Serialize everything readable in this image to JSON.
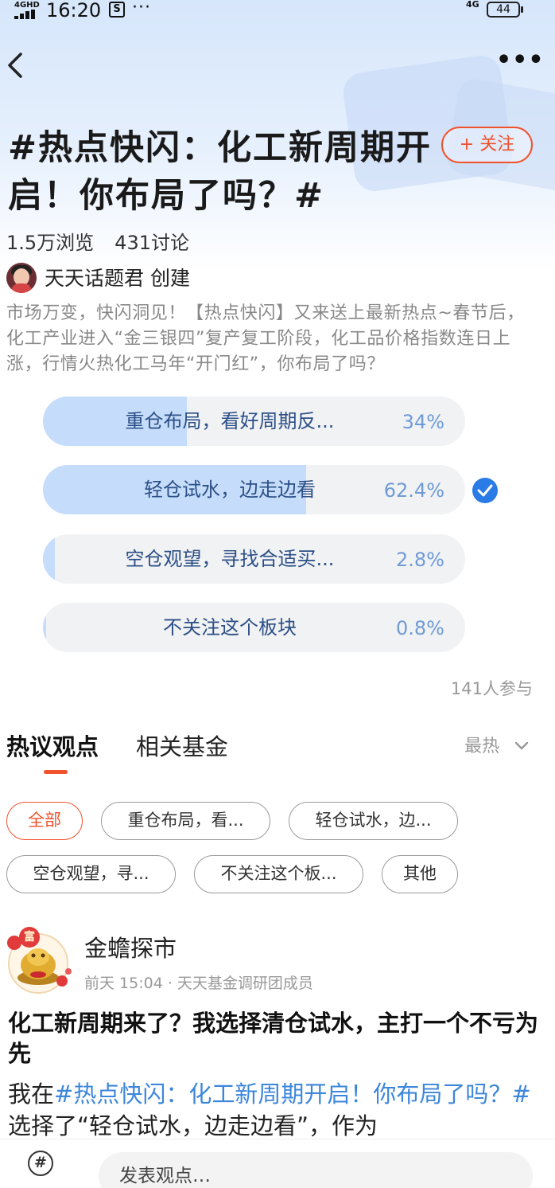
{
  "status_bar": {
    "network_left": "4GHD",
    "time": "16:20",
    "dots": "···",
    "network_right": "4G",
    "battery": "44"
  },
  "header": {
    "more_label": "•••",
    "follow_label": "+ 关注"
  },
  "topic": {
    "title": "#热点快闪：化工新周期开启！你布局了吗？#",
    "views": "1.5万浏览",
    "discussions": "431讨论",
    "creator": "天天话题君 创建",
    "description": "市场万变，快闪洞见！【热点快闪】又来送上最新热点~春节后，化工产业进入“金三银四”复产复工阶段，化工品价格指数连日上涨，行情火热化工马年“开门红”，你布局了吗？"
  },
  "poll": {
    "options": [
      {
        "label": "重仓布局，看好周期反...",
        "percent": "34%",
        "value": 0.34,
        "selected": false
      },
      {
        "label": "轻仓试水，边走边看",
        "percent": "62.4%",
        "value": 0.624,
        "selected": true
      },
      {
        "label": "空仓观望，寻找合适买...",
        "percent": "2.8%",
        "value": 0.028,
        "selected": false
      },
      {
        "label": "不关注这个板块",
        "percent": "0.8%",
        "value": 0.008,
        "selected": false
      }
    ],
    "participants": "141人参与"
  },
  "tabs": {
    "hot": "热议观点",
    "funds": "相关基金",
    "sort": "最热"
  },
  "filters": [
    "全部",
    "重仓布局，看...",
    "轻仓试水，边...",
    "空仓观望，寻...",
    "不关注这个板...",
    "其他"
  ],
  "post": {
    "author": "金蟾探市",
    "badge_char": "富",
    "time": "前天 15:04",
    "role": "天天基金调研团成员",
    "title": "化工新周期来了？我选择清仓试水，主打一个不亏为先",
    "body_prefix": "我在",
    "body_topic": "#热点快闪：化工新周期开启！你布局了吗？#",
    "body_suffix": "选择了“轻仓试水，边走边看”，作为"
  },
  "bottom_bar": {
    "hash_icon": "#",
    "compose_placeholder": "发表观点…"
  },
  "colors": {
    "accent": "#f0522c",
    "link": "#3c86db",
    "poll_fill": "#c5dcfa",
    "check": "#2b7be6"
  }
}
